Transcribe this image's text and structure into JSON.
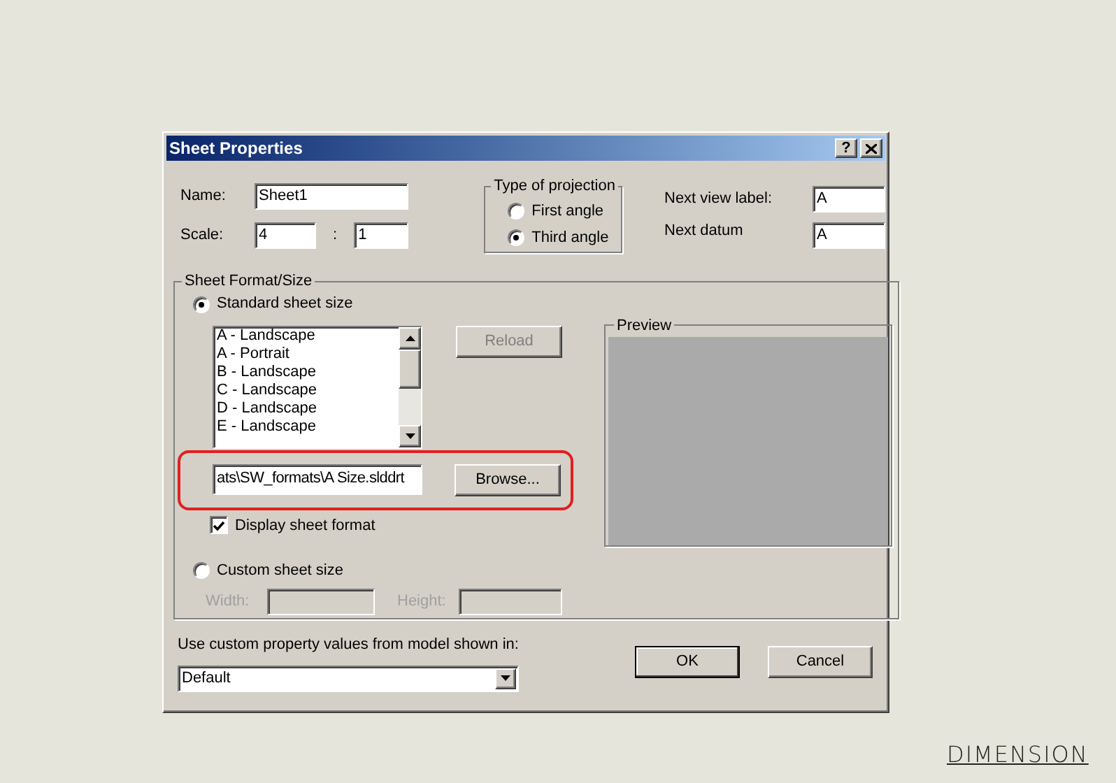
{
  "window": {
    "title": "Sheet Properties",
    "help_button": "?"
  },
  "name": {
    "label": "Name:",
    "value": "Sheet1"
  },
  "scale": {
    "label": "Scale:",
    "numerator": "4",
    "separator": ":",
    "denominator": "1"
  },
  "projection": {
    "title": "Type of projection",
    "options": [
      {
        "label": "First angle",
        "selected": false
      },
      {
        "label": "Third angle",
        "selected": true
      }
    ]
  },
  "next_view_label": {
    "label": "Next view label:",
    "value": "A"
  },
  "next_datum": {
    "label": "Next datum",
    "value": "A"
  },
  "sheet_format": {
    "title": "Sheet Format/Size",
    "standard_size": {
      "label": "Standard sheet size",
      "selected": true
    },
    "sizes": [
      "A - Landscape",
      "A - Portrait",
      "B - Landscape",
      "C - Landscape",
      "D - Landscape",
      "E - Landscape"
    ],
    "reload_button": {
      "label": "Reload",
      "disabled": true
    },
    "format_path": "ats\\SW_formats\\A Size.slddrt",
    "browse_button": "Browse...",
    "display_sheet_format": {
      "label": "Display sheet format",
      "checked": true
    },
    "custom_size": {
      "label": "Custom sheet size",
      "selected": false
    },
    "width": {
      "label": "Width:",
      "disabled": true
    },
    "height": {
      "label": "Height:",
      "disabled": true
    },
    "preview": {
      "title": "Preview"
    }
  },
  "custom_property": {
    "label": "Use custom property values from model shown in:",
    "value": "Default"
  },
  "buttons": [
    "OK",
    "Cancel"
  ],
  "footer_label": "DIMENSION"
}
